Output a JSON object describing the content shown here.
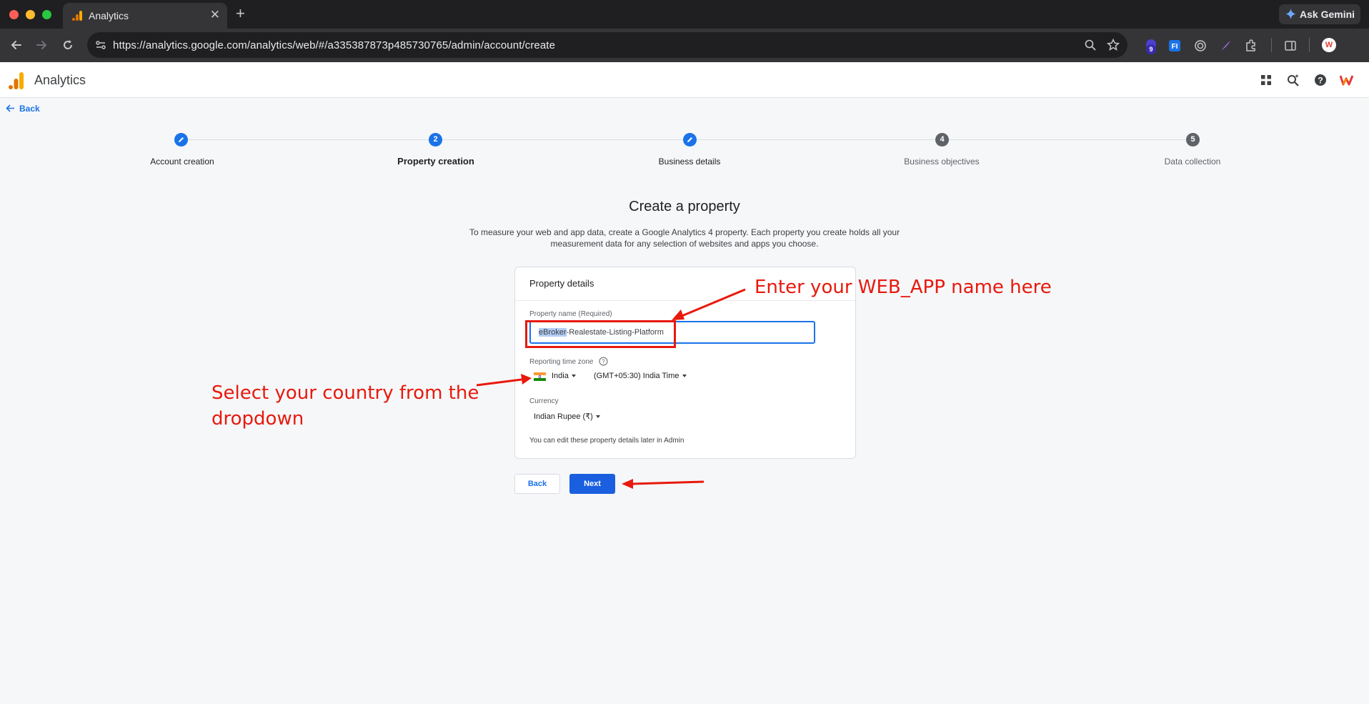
{
  "browser": {
    "tab_title": "Analytics",
    "tab_close": "✕",
    "new_tab": "+",
    "url": "https://analytics.google.com/analytics/web/#/a335387873p485730765/admin/account/create",
    "gemini_label": "Ask Gemini",
    "extension_badge": "9",
    "profile_initial": "W"
  },
  "app": {
    "title": "Analytics",
    "back_link": "Back"
  },
  "stepper": {
    "steps": [
      {
        "number": "",
        "label": "Account creation",
        "state": "completed"
      },
      {
        "number": "2",
        "label": "Property creation",
        "state": "current"
      },
      {
        "number": "",
        "label": "Business details",
        "state": "completed"
      },
      {
        "number": "4",
        "label": "Business objectives",
        "state": "pending"
      },
      {
        "number": "5",
        "label": "Data collection",
        "state": "pending"
      }
    ]
  },
  "page": {
    "title": "Create a property",
    "description_line1": "To measure your web and app data, create a Google Analytics 4 property. Each property you create holds all your",
    "description_line2": "measurement data for any selection of websites and apps you choose."
  },
  "card": {
    "title": "Property details",
    "property_name_label": "Property name (Required)",
    "property_name_selected": "eBroker",
    "property_name_rest": "-Realestate-Listing-Platform",
    "timezone_label": "Reporting time zone",
    "country": "India",
    "timezone": "(GMT+05:30) India Time",
    "currency_label": "Currency",
    "currency": "Indian Rupee (₹)",
    "edit_note": "You can edit these property details later in Admin"
  },
  "buttons": {
    "back": "Back",
    "next": "Next"
  },
  "annotations": {
    "name_hint": "Enter your WEB_APP name here",
    "country_hint_line1": "Select your country from the",
    "country_hint_line2": "dropdown",
    "color": "#e8190d"
  },
  "colors": {
    "accent": "#1a73e8",
    "next_button": "#1a5fe0",
    "annotation": "#e8190d"
  }
}
